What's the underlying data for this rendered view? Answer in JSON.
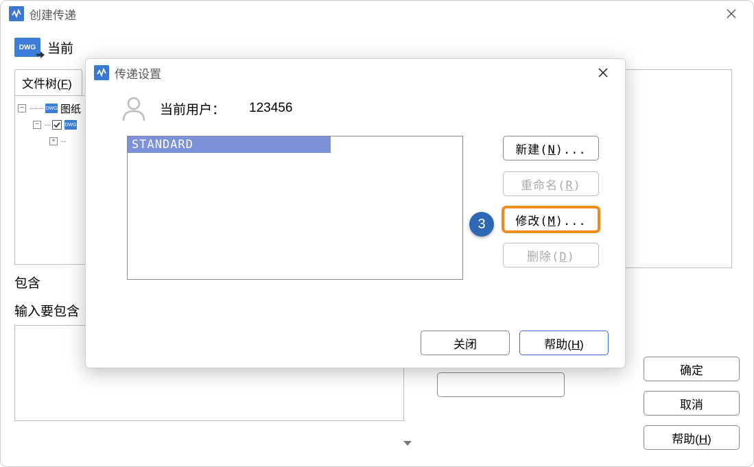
{
  "main_window": {
    "title": "创建传递",
    "dwg_label": "DWG",
    "top_label": "当前",
    "tab_label": "文件树(F)",
    "tree": {
      "root_label": "图纸",
      "dwg_small": "DWG"
    },
    "include_label": "包含",
    "include_char": "含",
    "note_label": "输入要包含",
    "buttons": {
      "ok": "确定",
      "cancel": "取消",
      "help": "帮助(H)",
      "help_pre": "帮助(",
      "help_key": "H",
      "help_post": ")"
    }
  },
  "dialog": {
    "title": "传递设置",
    "user_label": "当前用户：",
    "user_value": "123456",
    "list_item": "STANDARD",
    "buttons": {
      "new_pre": "新建(",
      "new_key": "N",
      "new_post": ")...",
      "rename_pre": "重命名(",
      "rename_key": "R",
      "rename_post": ")",
      "modify_pre": "修改(",
      "modify_key": "M",
      "modify_post": ")...",
      "delete_pre": "删除(",
      "delete_key": "D",
      "delete_post": ")",
      "close": "关闭",
      "help_pre": "帮助(",
      "help_key": "H",
      "help_post": ")"
    },
    "step_badge": "3"
  }
}
